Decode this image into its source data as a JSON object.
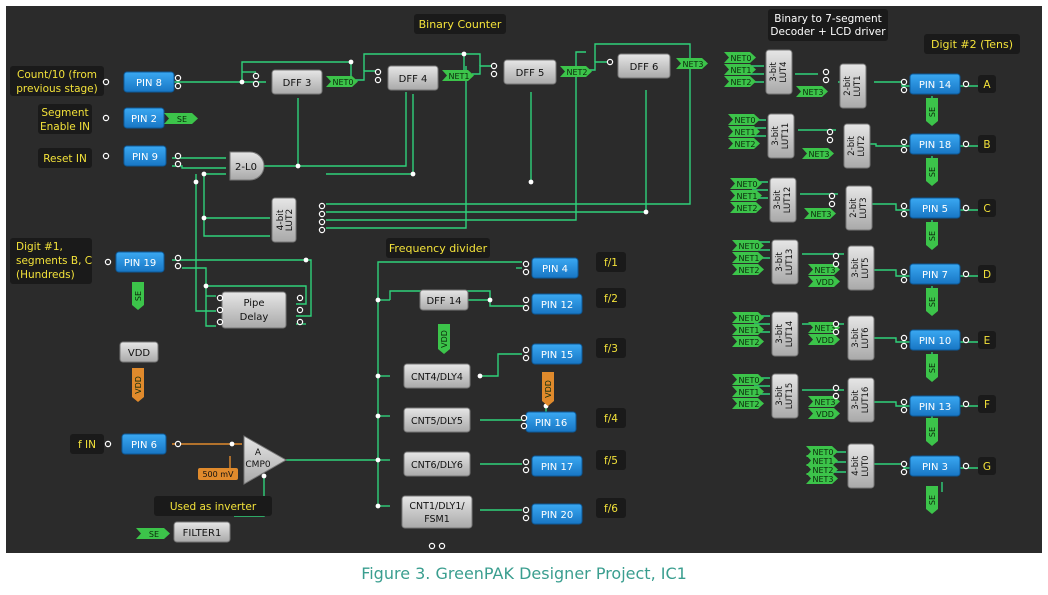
{
  "caption": "Figure 3. GreenPAK Designer Project, IC1",
  "colors": {
    "background": "#2b2b2b",
    "wire": "#2fd17a",
    "wire_orange": "#e08a2c",
    "pin_fill": "#1e8fe0",
    "block_fill": "#c8c8c8",
    "label_box": "#1a1a1a",
    "label_text": "#f3e23a",
    "flag_green": "#3cc44a",
    "flag_orange": "#e08a2c"
  },
  "titles": {
    "binary_counter": "Binary Counter",
    "decoder_line1": "Binary to 7-segment",
    "decoder_line2": "Decoder + LCD driver",
    "digit2": "Digit #2 (Tens)",
    "freq_divider": "Frequency divider"
  },
  "inputs": {
    "count": [
      "Count/10 (from",
      "previous stage)"
    ],
    "segment": [
      "Segment",
      "Enable IN"
    ],
    "reset": "Reset IN",
    "digit1": [
      "Digit #1,",
      "segments B, C",
      "(Hundreds)"
    ],
    "fin": "f IN",
    "inverter": "Used as inverter"
  },
  "pins": {
    "pin8": "PIN 8",
    "pin2": "PIN 2",
    "pin9": "PIN 9",
    "pin19": "PIN 19",
    "pin6": "PIN 6",
    "pin4": "PIN 4",
    "pin12": "PIN 12",
    "pin15": "PIN 15",
    "pin16": "PIN 16",
    "pin17": "PIN 17",
    "pin20": "PIN 20",
    "pin14": "PIN 14",
    "pin18": "PIN 18",
    "pin5": "PIN 5",
    "pin7": "PIN 7",
    "pin10": "PIN 10",
    "pin13": "PIN 13",
    "pin3": "PIN 3"
  },
  "blocks": {
    "dff3": "DFF 3",
    "dff4": "DFF 4",
    "dff5": "DFF 5",
    "dff6": "DFF 6",
    "dff14": "DFF 14",
    "l0": "2-L0",
    "lut2_4bit": [
      "4-bit",
      "LUT2"
    ],
    "pipe_delay": [
      "Pipe",
      "Delay"
    ],
    "vdd_block": "VDD",
    "cmp": [
      "A",
      "CMP0"
    ],
    "cnt4": "CNT4/DLY4",
    "cnt5": "CNT5/DLY5",
    "cnt6": "CNT6/DLY6",
    "cnt1": [
      "CNT1/DLY1/",
      "FSM1"
    ],
    "filter1": "FILTER1",
    "ref500": "500 mV"
  },
  "nets": {
    "net0": "NET0",
    "net1": "NET1",
    "net2": "NET2",
    "net3": "NET3",
    "se": "SE",
    "vdd": "VDD"
  },
  "freq_outputs": [
    "f/1",
    "f/2",
    "f/3",
    "f/4",
    "f/5",
    "f/6"
  ],
  "segments": [
    "A",
    "B",
    "C",
    "D",
    "E",
    "F",
    "G"
  ],
  "decoder_luts": [
    {
      "l1": "3-bit",
      "l2": "LUT4",
      "r1": "2-bit",
      "r2": "LUT1"
    },
    {
      "l1": "3-bit",
      "l2": "LUT11",
      "r1": "2-bit",
      "r2": "LUT2"
    },
    {
      "l1": "3-bit",
      "l2": "LUT12",
      "r1": "2-bit",
      "r2": "LUT3"
    },
    {
      "l1": "3-bit",
      "l2": "LUT13",
      "r1": "3-bit",
      "r2": "LUT5"
    },
    {
      "l1": "3-bit",
      "l2": "LUT14",
      "r1": "3-bit",
      "r2": "LUT6"
    },
    {
      "l1": "3-bit",
      "l2": "LUT15",
      "r1": "3-bit",
      "r2": "LUT16"
    },
    {
      "l1": "4-bit",
      "l2": "LUT0"
    }
  ]
}
